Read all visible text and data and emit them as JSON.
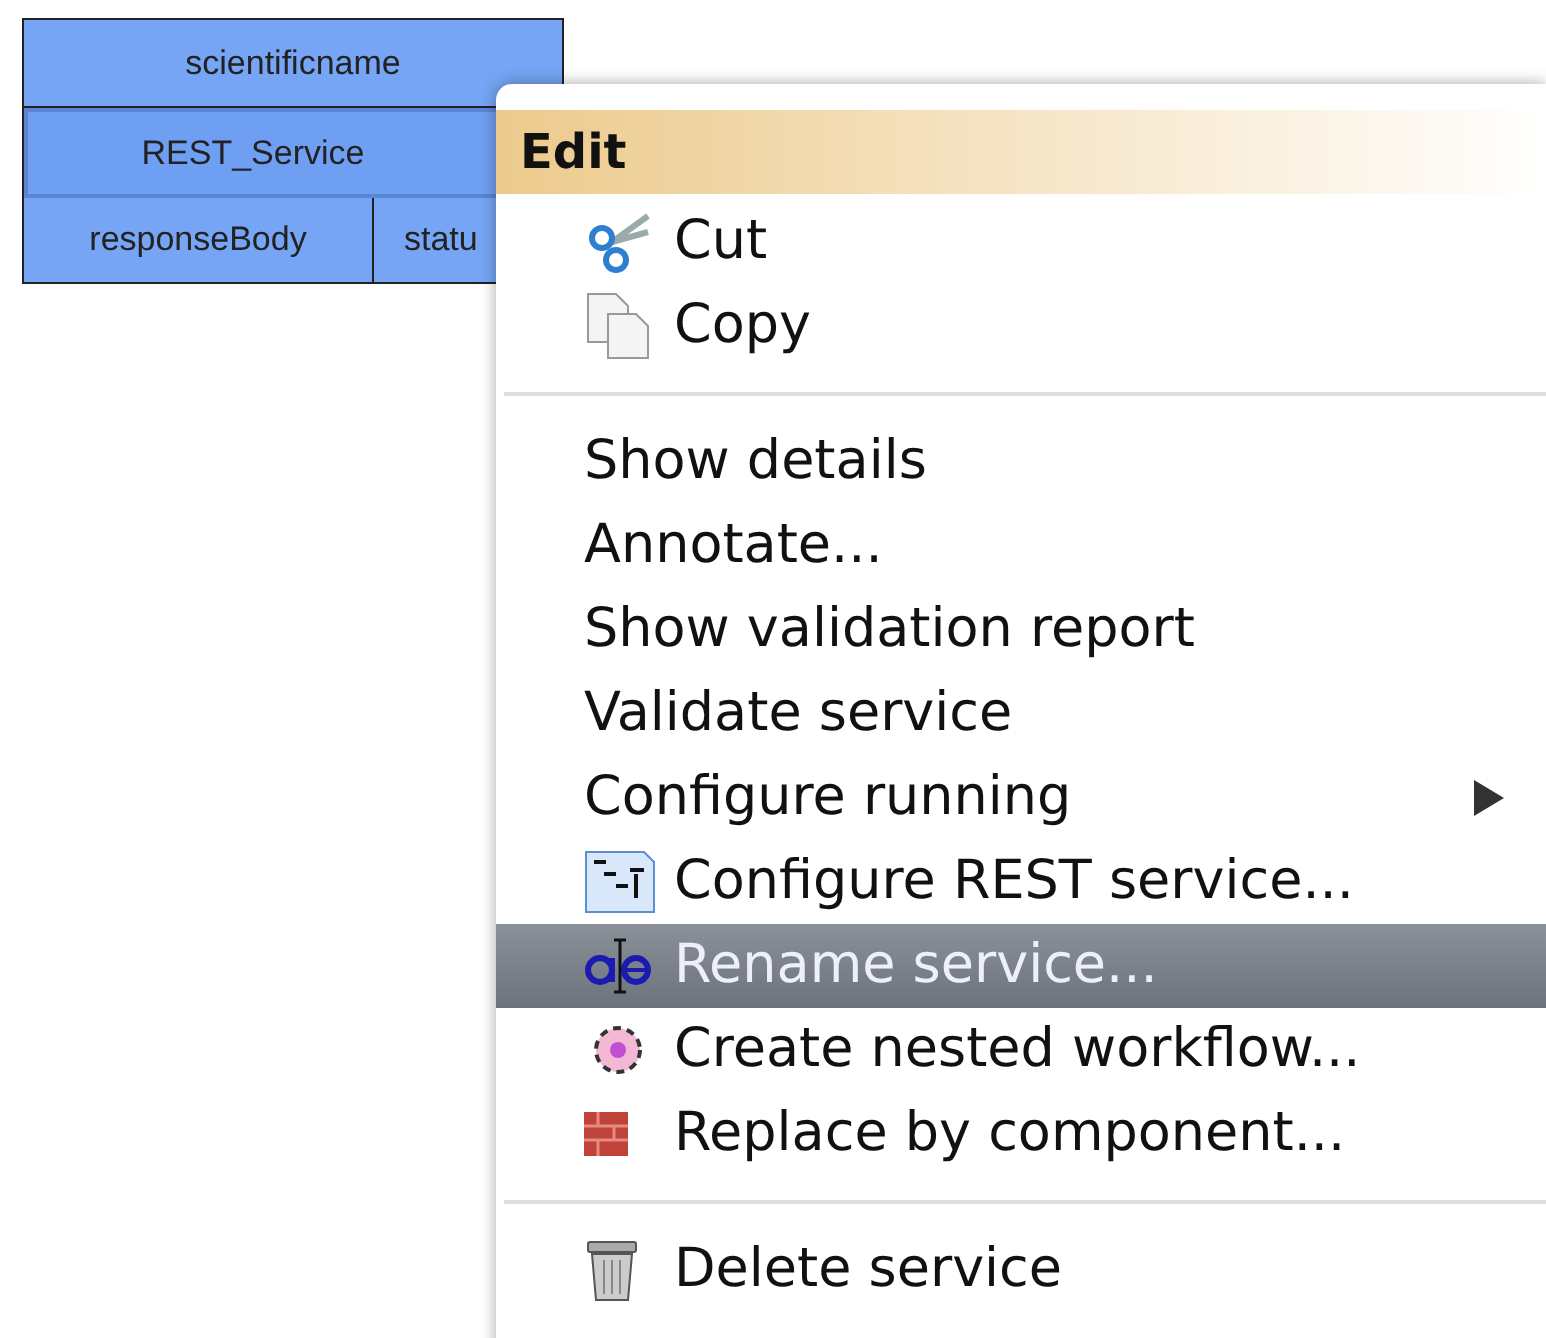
{
  "node": {
    "title": "scientificname",
    "service": "REST_Service",
    "ports": [
      "responseBody",
      "statu"
    ]
  },
  "menu": {
    "header": "Edit",
    "sections": [
      [
        {
          "label": "Cut",
          "kind": "cut",
          "selected": false,
          "submenu": false
        },
        {
          "label": "Copy",
          "kind": "copy",
          "selected": false,
          "submenu": false
        }
      ],
      [
        {
          "label": "Show details",
          "kind": "plain",
          "selected": false,
          "submenu": false
        },
        {
          "label": "Annotate...",
          "kind": "plain",
          "selected": false,
          "submenu": false
        },
        {
          "label": "Show validation report",
          "kind": "plain",
          "selected": false,
          "submenu": false
        },
        {
          "label": "Validate service",
          "kind": "plain",
          "selected": false,
          "submenu": false
        },
        {
          "label": "Configure running",
          "kind": "plain",
          "selected": false,
          "submenu": true
        },
        {
          "label": "Configure REST service...",
          "kind": "rest",
          "selected": false,
          "submenu": false
        },
        {
          "label": "Rename service...",
          "kind": "rename",
          "selected": true,
          "submenu": false
        },
        {
          "label": "Create nested workflow...",
          "kind": "nested",
          "selected": false,
          "submenu": false
        },
        {
          "label": "Replace by component...",
          "kind": "replace",
          "selected": false,
          "submenu": false
        }
      ],
      [
        {
          "label": "Delete service",
          "kind": "delete",
          "selected": false,
          "submenu": false
        }
      ]
    ]
  }
}
